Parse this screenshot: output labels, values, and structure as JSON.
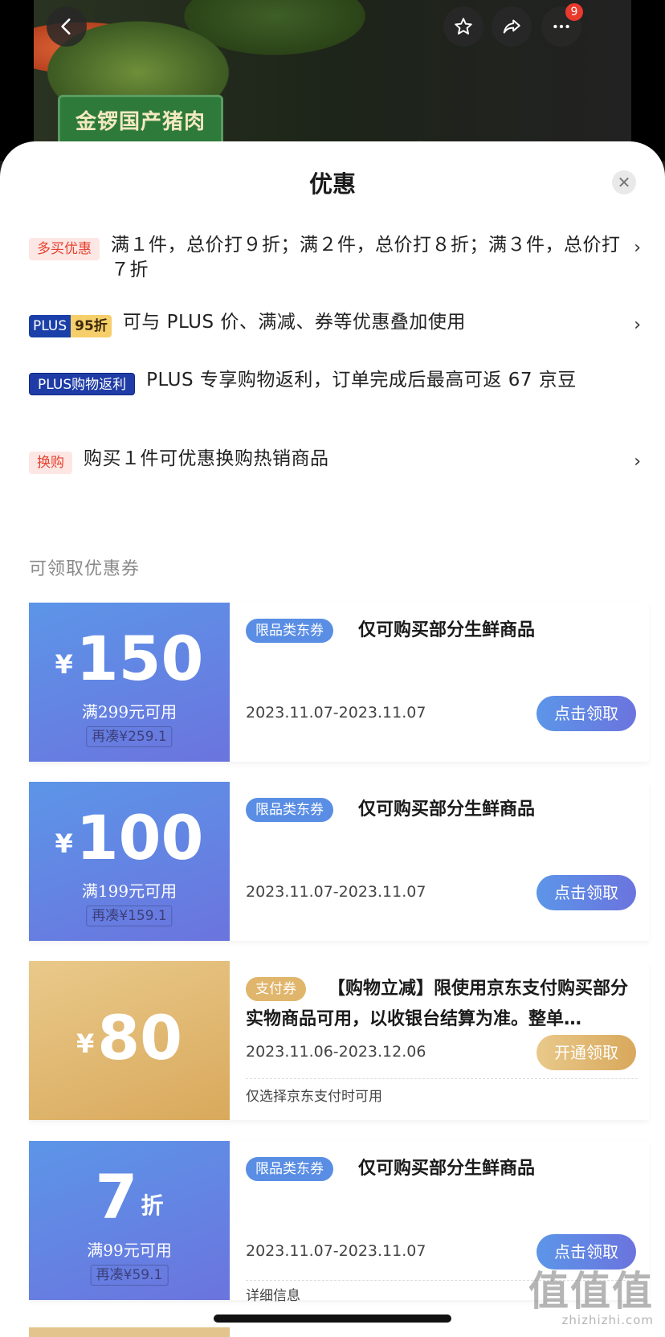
{
  "hero": {
    "badge_text": "金锣国产猪肉",
    "more_count": "9",
    "icons": [
      "back-icon",
      "star-icon",
      "share-icon",
      "more-icon"
    ]
  },
  "sheet": {
    "title": "优惠",
    "close_icon": "close-icon"
  },
  "promotions": [
    {
      "tag": "多买优惠",
      "text": "满１件，总价打９折；满２件，总价打８折；满３件，总价打７折",
      "chevron": "›"
    },
    {
      "tag_a": "PLUS",
      "tag_b": "95折",
      "text": "可与 PLUS 价、满减、券等优惠叠加使用",
      "chevron": "›"
    },
    {
      "tag": "PLUS购物返利",
      "text": "PLUS 专享购物返利，订单完成后最高可返 67 京豆"
    },
    {
      "tag": "换购",
      "text": "购买１件可优惠换购热销商品",
      "chevron": "›"
    }
  ],
  "coupons_section_title": "可领取优惠券",
  "coupons": [
    {
      "currency": "¥",
      "amount": "150",
      "condition": "满299元可用",
      "extra": "再凑¥259.1",
      "type": "限品类东券",
      "desc": "仅可购买部分生鲜商品",
      "date": "2023.11.07-2023.11.07",
      "button": "点击领取"
    },
    {
      "currency": "¥",
      "amount": "100",
      "condition": "满199元可用",
      "extra": "再凑¥159.1",
      "type": "限品类东券",
      "desc": "仅可购买部分生鲜商品",
      "date": "2023.11.07-2023.11.07",
      "button": "点击领取"
    },
    {
      "currency": "¥",
      "amount": "80",
      "type": "支付券",
      "desc": "【购物立减】限使用京东支付购买部分实物商品可用，以收银台结算为准。整单…",
      "date": "2023.11.06-2023.12.06",
      "button": "开通领取",
      "note": "仅选择京东支付时可用"
    },
    {
      "amount": "7",
      "unit": "折",
      "condition": "满99元可用",
      "extra": "再凑¥59.1",
      "type": "限品类东券",
      "desc": "仅可购买部分生鲜商品",
      "date": "2023.11.07-2023.11.07",
      "button": "点击领取",
      "note": "详细信息"
    }
  ],
  "watermark": {
    "big": "值值值",
    "small": "zhizhizhi.com"
  },
  "colors": {
    "coupon_blue": "#5c95e8",
    "coupon_gold": "#d9a95c",
    "tag_red": "#e5412f",
    "plus_blue": "#1a3fa8"
  }
}
